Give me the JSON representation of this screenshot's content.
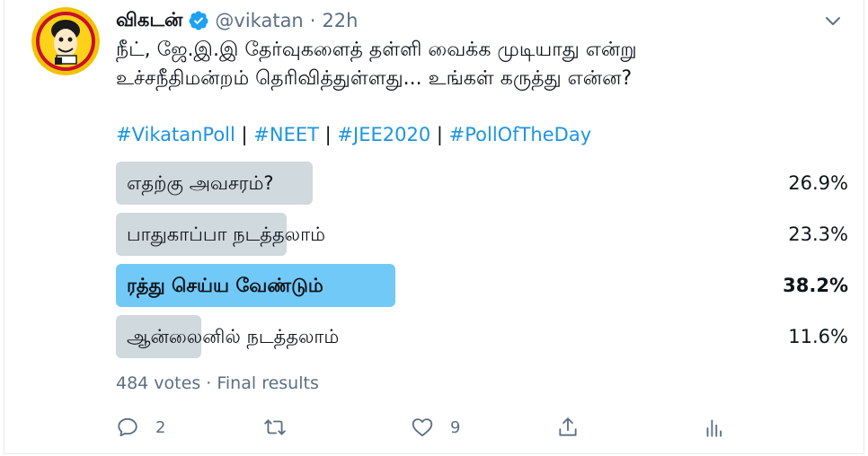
{
  "tweet": {
    "display_name": "விகடன்",
    "handle": "@vikatan",
    "separator": "·",
    "time": "22h",
    "text": "நீட், ஜே.இ.இ தேர்வுகளைத் தள்ளி வைக்க முடியாது என்று\nஉச்சநீதிமன்றம் தெரிவித்துள்ளது... உங்கள் கருத்து என்ன?",
    "hashtags": [
      "#VikatanPoll",
      "#NEET",
      "#JEE2020",
      "#PollOfTheDay"
    ],
    "hashtag_separator": "|"
  },
  "poll": {
    "options": [
      {
        "label": "எதற்கு அவசரம்?",
        "percent_label": "26.9%",
        "percent": 26.9,
        "winner": false
      },
      {
        "label": "பாதுகாப்பா நடத்தலாம்",
        "percent_label": "23.3%",
        "percent": 23.3,
        "winner": false
      },
      {
        "label": "ரத்து செய்ய வேண்டும்",
        "percent_label": "38.2%",
        "percent": 38.2,
        "winner": true
      },
      {
        "label": "ஆன்லைனில் நடத்தலாம்",
        "percent_label": "11.6%",
        "percent": 11.6,
        "winner": false
      }
    ],
    "votes": "484 votes",
    "separator": "·",
    "status": "Final results"
  },
  "actions": {
    "reply_count": "2",
    "like_count": "9"
  },
  "colors": {
    "hashtag": "#1b95e0",
    "bar": "#cfd9de",
    "bar_winner": "#71c9f8",
    "verified": "#1da1f2",
    "muted": "#5b7083"
  }
}
